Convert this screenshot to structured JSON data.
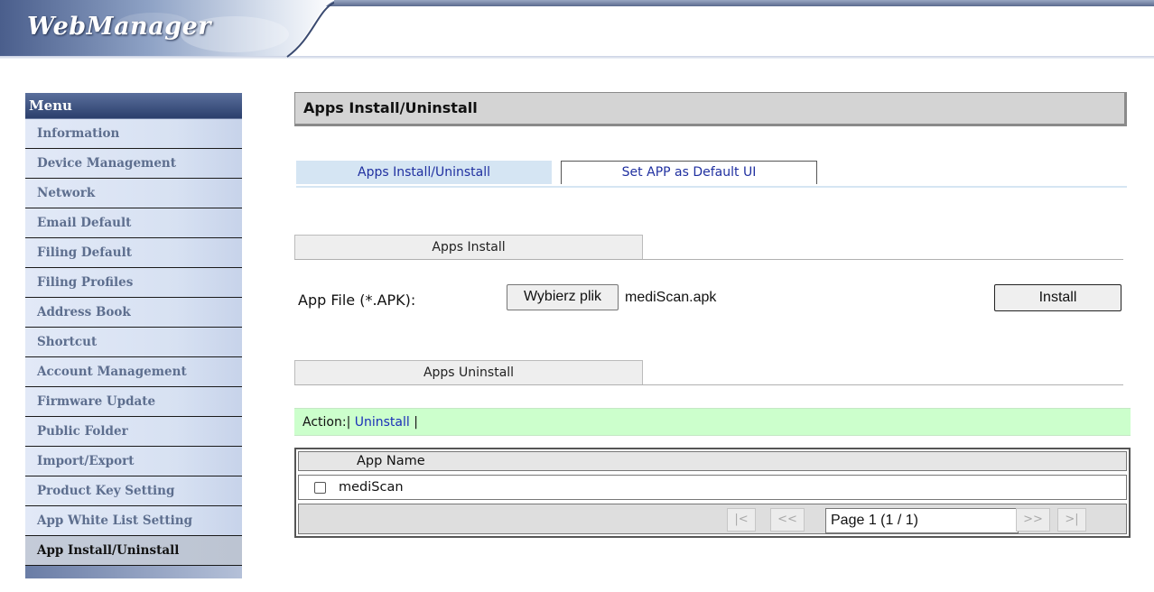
{
  "app": {
    "logo": "WebManager"
  },
  "sidebar": {
    "title": "Menu",
    "items": [
      {
        "label": "Information",
        "active": false
      },
      {
        "label": "Device Management",
        "active": false
      },
      {
        "label": "Network",
        "active": false
      },
      {
        "label": "Email Default",
        "active": false
      },
      {
        "label": "Filing Default",
        "active": false
      },
      {
        "label": "Filing Profiles",
        "active": false
      },
      {
        "label": "Address Book",
        "active": false
      },
      {
        "label": "Shortcut",
        "active": false
      },
      {
        "label": "Account Management",
        "active": false
      },
      {
        "label": "Firmware Update",
        "active": false
      },
      {
        "label": "Public Folder",
        "active": false
      },
      {
        "label": "Import/Export",
        "active": false
      },
      {
        "label": "Product Key Setting",
        "active": false
      },
      {
        "label": "App White List Setting",
        "active": false
      },
      {
        "label": "App Install/Uninstall",
        "active": true
      }
    ]
  },
  "main": {
    "title": "Apps Install/Uninstall",
    "tabs": [
      {
        "label": "Apps Install/Uninstall",
        "active": true
      },
      {
        "label": "Set APP as Default UI",
        "active": false
      }
    ],
    "install": {
      "section_title": "Apps Install",
      "file_label": "App File (*.APK):",
      "choose_button": "Wybierz plik",
      "selected_file": "mediScan.apk",
      "install_button": "Install"
    },
    "uninstall": {
      "section_title": "Apps Uninstall",
      "action_prefix": "Action:|",
      "action_link": "Uninstall",
      "action_suffix": "|",
      "table": {
        "header": "App Name",
        "rows": [
          {
            "name": "mediScan",
            "checked": false
          }
        ]
      },
      "pager": {
        "first": "|<",
        "prev": "<<",
        "page": "Page 1 (1 / 1)",
        "next": ">>",
        "last": ">|"
      }
    }
  },
  "colors": {
    "menu_header": "#2b3f6c",
    "menu_item_bg": "#d7e1f2",
    "menu_item_text": "#5d6e8e",
    "active_tab_bg": "#d5e5f3",
    "action_bar_bg": "#ccffcc",
    "link": "#1a2fb8"
  }
}
